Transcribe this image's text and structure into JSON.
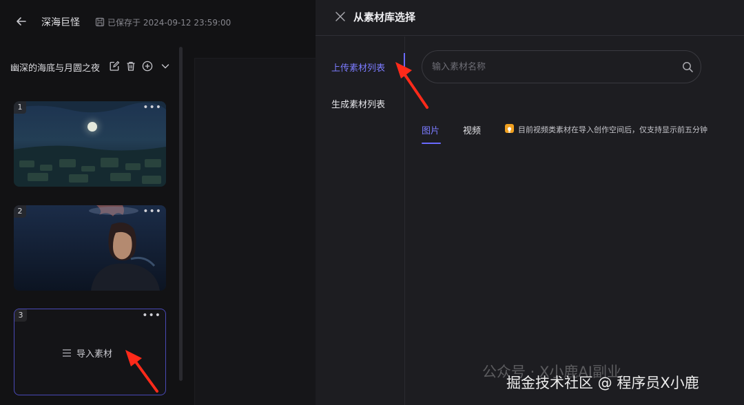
{
  "header": {
    "project_title": "深海巨怪",
    "saved_status": "已保存于 2024-09-12 23:59:00"
  },
  "scene": {
    "title": "幽深的海底与月圆之夜",
    "icons": [
      "edit-icon",
      "trash-icon",
      "add-circle-icon",
      "chevron-down-icon"
    ]
  },
  "cards": [
    {
      "number": "1",
      "more": "•••",
      "image": "moonlit-underwater-scene"
    },
    {
      "number": "2",
      "more": "•••",
      "image": "diver-underwater-portrait"
    },
    {
      "number": "3",
      "more": "•••",
      "import_label": "导入素材"
    }
  ],
  "panel": {
    "title": "从素材库选择",
    "nav": [
      {
        "label": "上传素材列表",
        "active": true
      },
      {
        "label": "生成素材列表",
        "active": false
      }
    ],
    "search": {
      "placeholder": "输入素材名称",
      "value": ""
    },
    "tabs": [
      {
        "label": "图片",
        "active": true
      },
      {
        "label": "视频",
        "active": false
      }
    ],
    "tip": "目前视频类素材在导入创作空间后，仅支持显示前五分钟"
  },
  "watermark": {
    "line1": "公众号 · X小鹿AI副业",
    "line2": "掘金技术社区 @ 程序员X小鹿"
  },
  "colors": {
    "accent": "#6a6aff",
    "panel_bg": "#1d1d21",
    "page_bg": "#111113",
    "arrow": "#ff2a1a"
  }
}
